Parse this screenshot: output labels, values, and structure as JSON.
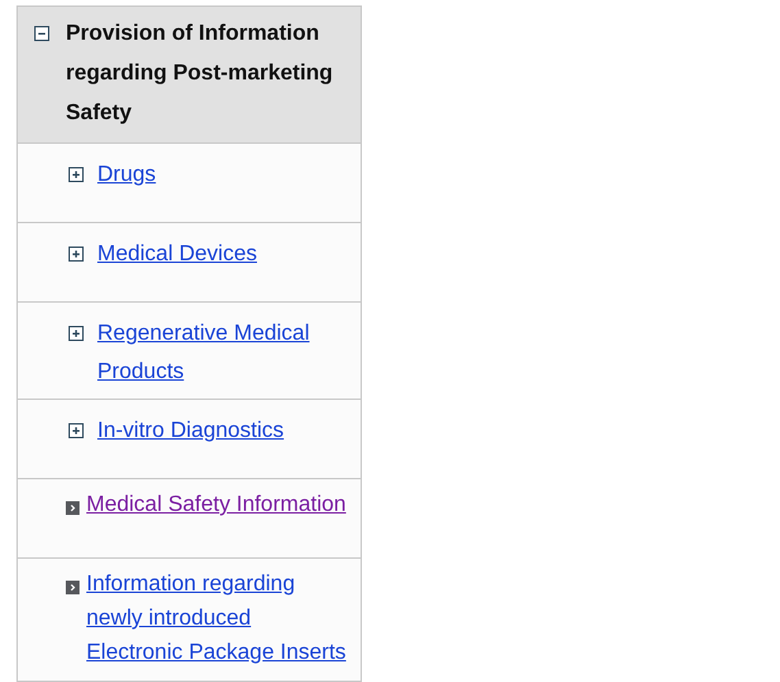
{
  "menu": {
    "title": "Provision of Information regarding Post-marketing Safety",
    "expanded": true,
    "items": [
      {
        "kind": "expandable",
        "label": "Drugs",
        "expanded": false,
        "visited": false
      },
      {
        "kind": "expandable",
        "label": "Medical Devices",
        "expanded": false,
        "visited": false
      },
      {
        "kind": "expandable",
        "label": "Regenerative Medical Products",
        "expanded": false,
        "visited": false
      },
      {
        "kind": "expandable",
        "label": "In-vitro Diagnostics",
        "expanded": false,
        "visited": false
      },
      {
        "kind": "link",
        "label": "Medical Safety Information",
        "visited": true
      },
      {
        "kind": "link",
        "label": "Information regarding newly introduced Electronic Package Inserts",
        "visited": false
      }
    ]
  }
}
